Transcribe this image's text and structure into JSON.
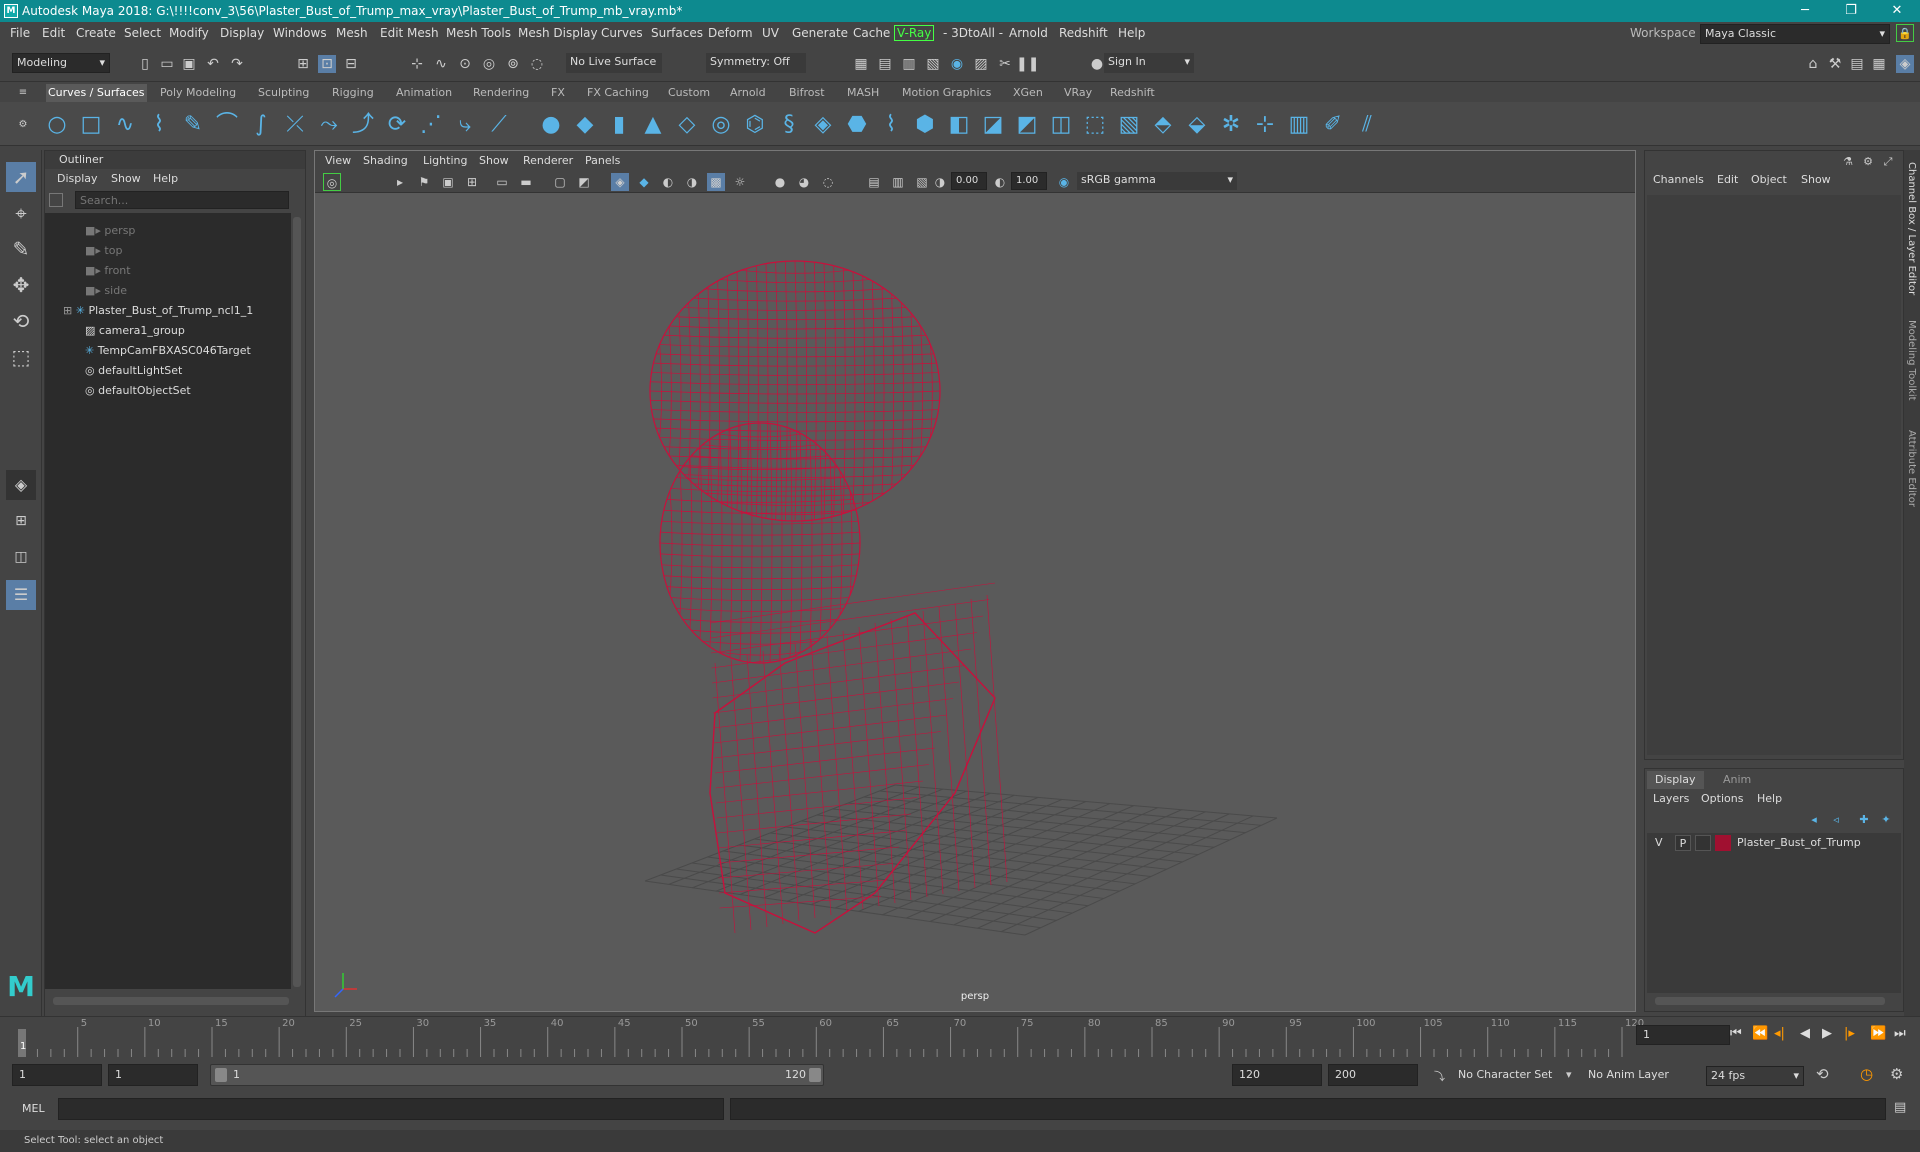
{
  "window": {
    "title": "Autodesk Maya 2018: G:\\!!!!conv_3\\56\\Plaster_Bust_of_Trump_max_vray\\Plaster_Bust_of_Trump_mb_vray.mb*"
  },
  "menubar": {
    "items": [
      "File",
      "Edit",
      "Create",
      "Select",
      "Modify",
      "Display",
      "Windows",
      "Mesh",
      "Edit Mesh",
      "Mesh Tools",
      "Mesh Display",
      "Curves",
      "Surfaces",
      "Deform",
      "UV",
      "Generate",
      "Cache",
      "V-Ray",
      "- 3DtoAll -",
      "Arnold",
      "Redshift",
      "Help"
    ],
    "workspace_label": "Workspace :",
    "workspace_value": "Maya Classic"
  },
  "statusline": {
    "mode": "Modeling",
    "live_surface": "No Live Surface",
    "symmetry": "Symmetry: Off",
    "sign_in": "Sign In"
  },
  "shelf": {
    "tabs": [
      "Curves / Surfaces",
      "Poly Modeling",
      "Sculpting",
      "Rigging",
      "Animation",
      "Rendering",
      "FX",
      "FX Caching",
      "Custom",
      "Arnold",
      "Bifrost",
      "MASH",
      "Motion Graphics",
      "XGen",
      "VRay",
      "Redshift"
    ],
    "active_tab": "Curves / Surfaces"
  },
  "outliner": {
    "title": "Outliner",
    "menu": [
      "Display",
      "Show",
      "Help"
    ],
    "search_placeholder": "Search...",
    "items": [
      {
        "label": "persp",
        "icon": "camera-icon",
        "dim": true
      },
      {
        "label": "top",
        "icon": "camera-icon",
        "dim": true
      },
      {
        "label": "front",
        "icon": "camera-icon",
        "dim": true
      },
      {
        "label": "side",
        "icon": "camera-icon",
        "dim": true
      },
      {
        "label": "Plaster_Bust_of_Trump_ncl1_1",
        "icon": "mesh-icon",
        "dim": false,
        "expandable": true
      },
      {
        "label": "camera1_group",
        "icon": "group-icon",
        "dim": false
      },
      {
        "label": "TempCamFBXASC046Target",
        "icon": "locator-icon",
        "dim": false
      },
      {
        "label": "defaultLightSet",
        "icon": "set-icon",
        "dim": false
      },
      {
        "label": "defaultObjectSet",
        "icon": "set-icon",
        "dim": false
      }
    ]
  },
  "viewport": {
    "menu": [
      "View",
      "Shading",
      "Lighting",
      "Show",
      "Renderer",
      "Panels"
    ],
    "exposure": "0.00",
    "gamma": "1.00",
    "color_space": "sRGB gamma",
    "camera_label": "persp",
    "wire_color": "#c8103c"
  },
  "channel_box": {
    "menu": [
      "Channels",
      "Edit",
      "Object",
      "Show"
    ]
  },
  "layer_editor": {
    "tabs": [
      "Display",
      "Anim"
    ],
    "menu": [
      "Layers",
      "Options",
      "Help"
    ],
    "layer": {
      "v": "V",
      "p": "P",
      "name": "Plaster_Bust_of_Trump",
      "color": "#a01030"
    }
  },
  "side_tabs": [
    "Channel Box / Layer Editor",
    "Modeling Toolkit",
    "Attribute Editor"
  ],
  "timeline": {
    "ticks": [
      "5",
      "10",
      "15",
      "20",
      "25",
      "30",
      "35",
      "40",
      "45",
      "50",
      "55",
      "60",
      "65",
      "70",
      "75",
      "80",
      "85",
      "90",
      "95",
      "100",
      "105",
      "110",
      "115",
      "120"
    ],
    "start_mark": "1",
    "current_frame": "1"
  },
  "range": {
    "start": "1",
    "anim_start": "1",
    "slider_start": "1",
    "slider_end": "120",
    "anim_end": "120",
    "end": "200",
    "character_set": "No Character Set",
    "anim_layer": "No Anim Layer",
    "fps": "24 fps"
  },
  "command": {
    "label": "MEL"
  },
  "help_line": "Select Tool: select an object"
}
